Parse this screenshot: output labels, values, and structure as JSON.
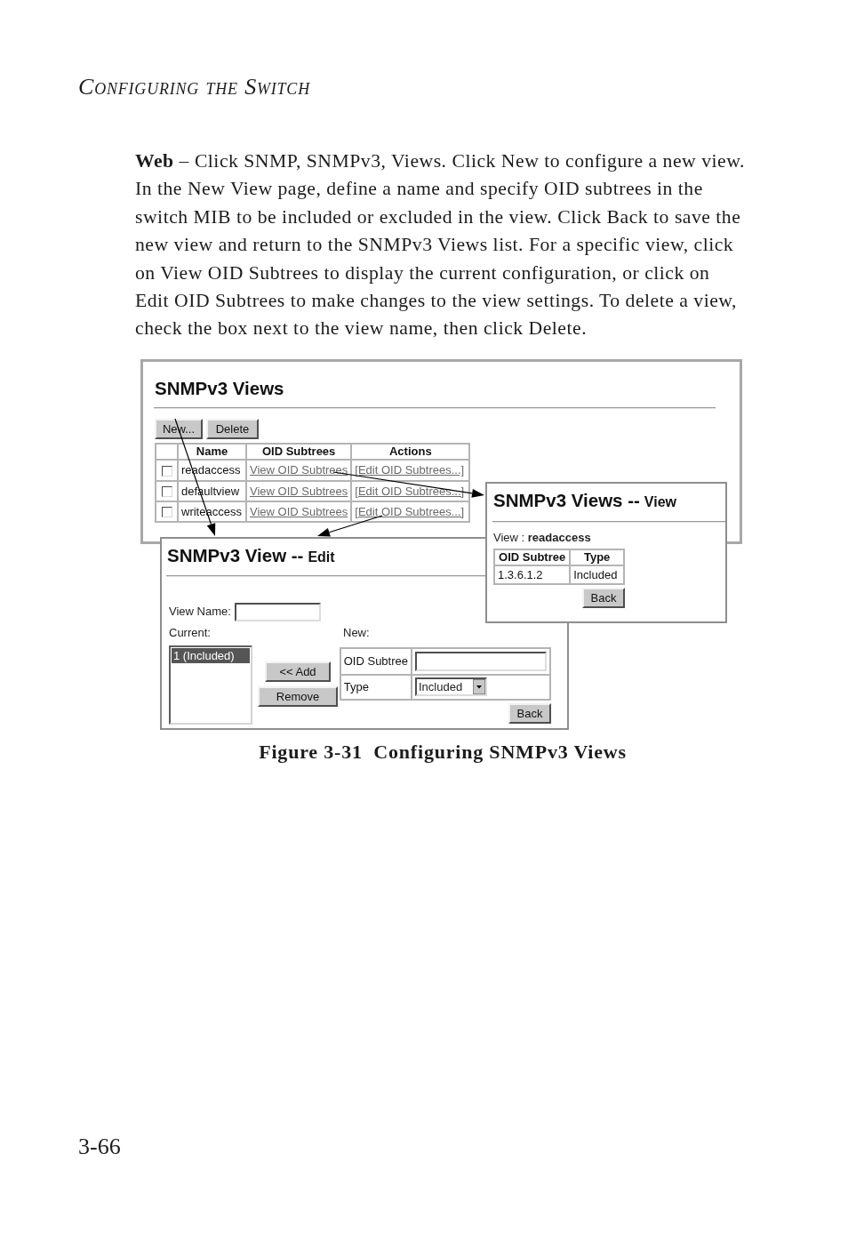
{
  "header": {
    "running_title": "Configuring the Switch"
  },
  "body": {
    "paragraph": "**Web** – Click SNMP, SNMPv3, Views. Click New to configure a new view. In the New View page, define a name and specify OID subtrees in the switch MIB to be included or excluded in the view. Click Back to save the new view and return to the SNMPv3 Views list. For a specific view, click on View OID Subtrees to display the current configuration, or click on Edit OID Subtrees to make changes to the view settings. To delete a view, check the box next to the view name, then click Delete."
  },
  "figure": {
    "views_list": {
      "title": "SNMPv3 Views",
      "buttons": [
        "New...",
        "Delete"
      ],
      "table": {
        "columns": [
          "Name",
          "OID Subtrees",
          "Actions"
        ],
        "rows": [
          {
            "checked": false,
            "name": "readaccess",
            "subtrees": "View OID Subtrees",
            "action": "[Edit OID Subtrees...]"
          },
          {
            "checked": false,
            "name": "defaultview",
            "subtrees": "View OID Subtrees",
            "action": "[Edit OID Subtrees...]"
          },
          {
            "checked": false,
            "name": "writeaccess",
            "subtrees": "View OID Subtrees",
            "action": "[Edit OID Subtrees...]"
          }
        ]
      }
    },
    "view_detail": {
      "title": "SNMPv3 Views --",
      "subtitle": "View",
      "view_line": "View : **readaccess**",
      "table": {
        "columns": [
          "OID Subtree",
          "Type"
        ],
        "rows": [
          {
            "oid_subtree": "1.3.6.1.2",
            "type": "Included"
          }
        ]
      },
      "button": "Back"
    },
    "view_edit": {
      "title": "SNMPv3 View --",
      "subtitle": "Edit",
      "view_name_label": "View Name:",
      "current_label": "Current:",
      "current_list": [
        {
          "label": "1 (Included)",
          "selected": true
        }
      ],
      "add_button": "<< Add",
      "remove_button": "Remove",
      "new_label": "New:",
      "new_fields": [
        {
          "kind": "text",
          "label": "OID Subtree"
        },
        {
          "kind": "select",
          "label": "Type",
          "value": "Included"
        }
      ],
      "back_button": "Back"
    },
    "caption": "Figure 3-31  Configuring SNMPv3 Views"
  },
  "page_number": "3-66"
}
